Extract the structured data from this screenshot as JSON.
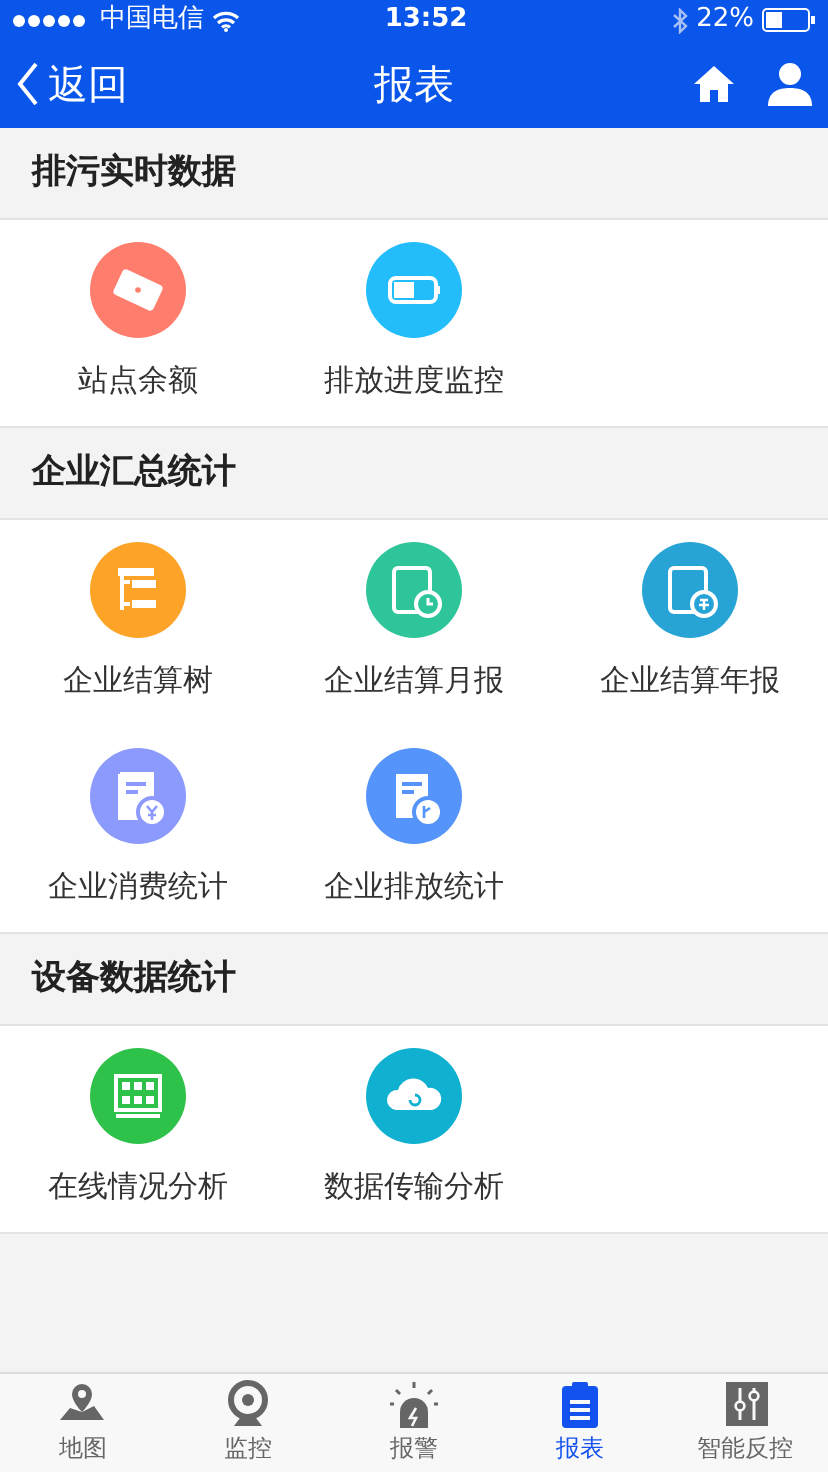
{
  "status_bar": {
    "carrier": "中国电信",
    "time": "13:52",
    "battery": "22%"
  },
  "nav": {
    "back": "返回",
    "title": "报表"
  },
  "sections": [
    {
      "title": "排污实时数据",
      "items": [
        {
          "label": "站点余额",
          "kind": "card",
          "color": "#fe7d6c"
        },
        {
          "label": "排放进度监控",
          "kind": "progress",
          "color": "#23bdfb"
        }
      ]
    },
    {
      "title": "企业汇总统计",
      "items": [
        {
          "label": "企业结算树",
          "kind": "tree",
          "color": "#fda428"
        },
        {
          "label": "企业结算月报",
          "kind": "month",
          "color": "#2fc59b"
        },
        {
          "label": "企业结算年报",
          "kind": "year",
          "color": "#27a4d5"
        },
        {
          "label": "企业消费统计",
          "kind": "consume",
          "color": "#8c99fd"
        },
        {
          "label": "企业排放统计",
          "kind": "emit",
          "color": "#5594fa"
        }
      ]
    },
    {
      "title": "设备数据统计",
      "items": [
        {
          "label": "在线情况分析",
          "kind": "grid",
          "color": "#2fc24a"
        },
        {
          "label": "数据传输分析",
          "kind": "cloud",
          "color": "#10b0d0"
        }
      ]
    }
  ],
  "tabs": [
    {
      "label": "地图",
      "kind": "map",
      "selected": false
    },
    {
      "label": "监控",
      "kind": "camera",
      "selected": false
    },
    {
      "label": "报警",
      "kind": "alarm",
      "selected": false
    },
    {
      "label": "报表",
      "kind": "report",
      "selected": true
    },
    {
      "label": "智能反控",
      "kind": "control",
      "selected": false
    }
  ]
}
